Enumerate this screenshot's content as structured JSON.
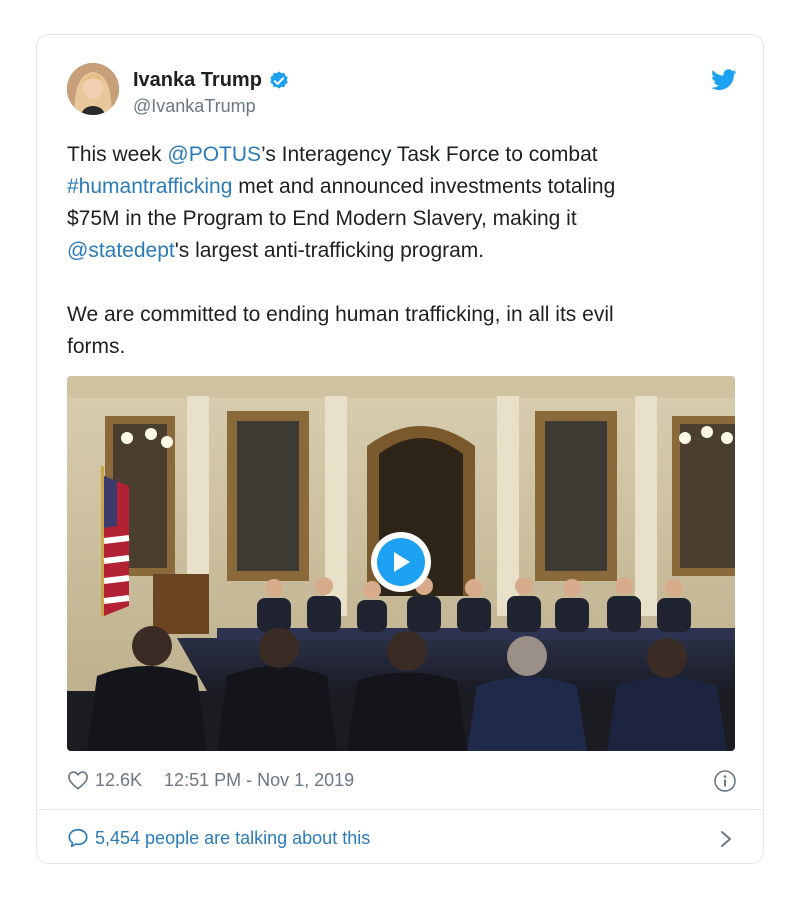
{
  "author": {
    "display_name": "Ivanka Trump",
    "handle": "@IvankaTrump",
    "verified": true
  },
  "tweet": {
    "segments": [
      {
        "text": "This week ",
        "type": "text"
      },
      {
        "text": "@POTUS",
        "type": "link"
      },
      {
        "text": "’s Interagency Task Force to combat\n",
        "type": "text"
      },
      {
        "text": "#humantrafficking",
        "type": "link"
      },
      {
        "text": " met and announced investments totaling\n$75M in the Program to End Modern Slavery, making it\n",
        "type": "text"
      },
      {
        "text": "@statedept",
        "type": "link"
      },
      {
        "text": "'s largest anti-trafficking program.\n\nWe are committed to ending human trafficking, in all its evil\nforms.",
        "type": "text"
      }
    ]
  },
  "media": {
    "type": "video",
    "play_icon": "play-icon"
  },
  "meta": {
    "likes": "12.6K",
    "timestamp": "12:51 PM - Nov 1, 2019"
  },
  "footer": {
    "conversation": "5,454 people are talking about this"
  },
  "colors": {
    "link": "#2b7bb9",
    "twitter_blue": "#1da1f2",
    "muted": "#697882",
    "border": "#e1e8ed"
  },
  "icons": [
    "verified-badge-icon",
    "twitter-bird-icon",
    "heart-icon",
    "info-icon",
    "speech-bubble-icon",
    "chevron-right-icon"
  ]
}
